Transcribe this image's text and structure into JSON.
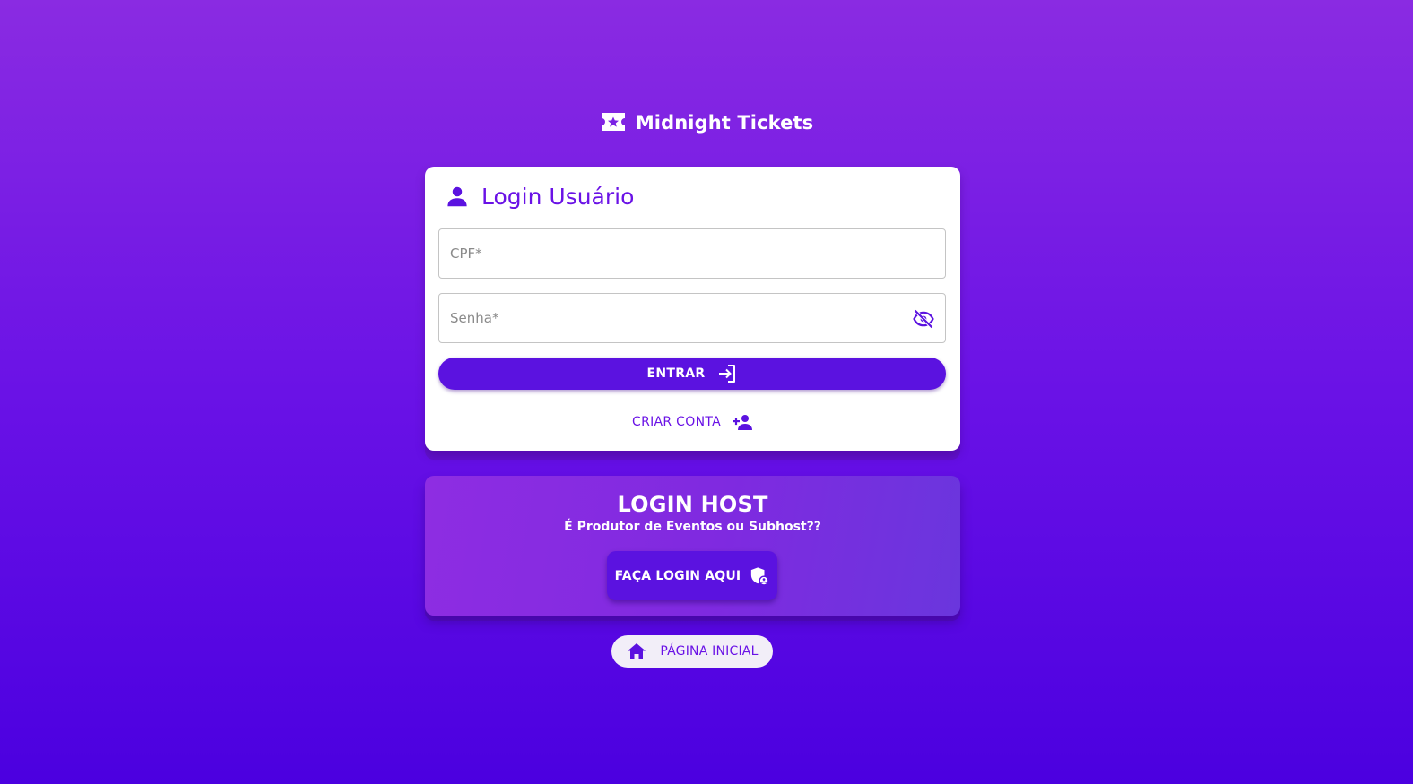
{
  "brand": {
    "name": "Midnight Tickets",
    "icon": "ticket-star-icon"
  },
  "login_card": {
    "title": "Login Usuário",
    "title_icon": "user-icon",
    "cpf_placeholder": "CPF*",
    "cpf_value": "",
    "password_placeholder": "Senha*",
    "password_value": "",
    "password_toggle_icon": "eye-off-icon",
    "submit_label": "ENTRAR",
    "submit_icon": "login-icon",
    "create_account_label": "CRIAR CONTA",
    "create_account_icon": "add-user-icon"
  },
  "host_card": {
    "title": "LOGIN HOST",
    "subtitle": "É Produtor de Eventos ou Subhost??",
    "button_label": "FAÇA LOGIN AQUI",
    "button_icon": "admin-shield-icon"
  },
  "home_button": {
    "label": "PÁGINA INICIAL",
    "icon": "home-icon"
  },
  "colors": {
    "accent": "#5b12e0",
    "text_accent": "#6a12e6",
    "background_top": "#8a2be2",
    "background_bottom": "#4b00e0"
  }
}
